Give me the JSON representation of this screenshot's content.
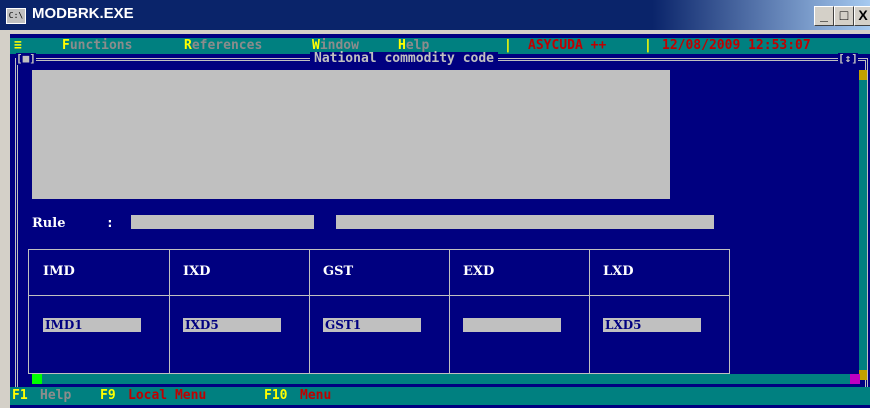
{
  "window": {
    "title": "MODBRK.EXE",
    "icon_label": "C:\\",
    "minimize_label": "_",
    "maximize_label": "□",
    "close_label": "X"
  },
  "menubar": {
    "system": "≡",
    "items": [
      {
        "hot": "F",
        "rest": "unctions"
      },
      {
        "hot": "R",
        "rest": "eferences"
      },
      {
        "hot": "W",
        "rest": "indow"
      },
      {
        "hot": "H",
        "rest": "elp"
      }
    ],
    "separator": "|",
    "app_name": "ASYCUDA ++",
    "datetime": "12/08/2009 12:53:07"
  },
  "dialog": {
    "title": "National commodity code",
    "close_box": "[■]",
    "zoom_box": "[↕]"
  },
  "rule": {
    "label": "Rule",
    "colon": ":",
    "value1": "",
    "value2": ""
  },
  "grid": {
    "columns": [
      {
        "header": "IMD",
        "value": "IMD1"
      },
      {
        "header": "IXD",
        "value": "IXD5"
      },
      {
        "header": "GST",
        "value": "GST1"
      },
      {
        "header": "EXD",
        "value": ""
      },
      {
        "header": "LXD",
        "value": "LXD5"
      }
    ]
  },
  "statusbar": {
    "items": [
      {
        "key": "F1",
        "label": "Help"
      },
      {
        "key": "F9",
        "label": "Local Menu"
      },
      {
        "key": "F10",
        "label": "Menu"
      }
    ]
  },
  "colors": {
    "console_bg": "#000080",
    "menu_bg": "#008080",
    "hotkey": "#ffff00",
    "field_bg": "#c0c0c0",
    "accent_red": "#c00000"
  }
}
